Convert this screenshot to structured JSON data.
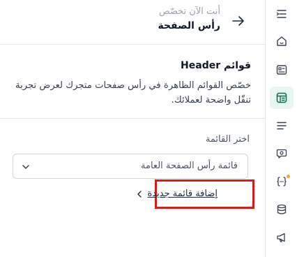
{
  "header": {
    "subtitle": "أنت الآن تخصّص",
    "title": "رأس الصفحة",
    "back_icon": "arrow-right-icon"
  },
  "menus_section": {
    "title": "قوائم Header",
    "description": "خصّص القوائم الظاهرة في رأس صفحات متجرك لعرض تجربة تنقّل واضحة لعملائك."
  },
  "menu_select": {
    "label": "اختر القائمة",
    "value": "قائمة رأس الصفحة العامة",
    "icon": "chevron-down-icon"
  },
  "add_menu": {
    "label": "إضافة قائمة جديدة",
    "icon": "chevron-left-icon",
    "highlight_color": "#d41c1c"
  },
  "sidebar": {
    "active_index": 3,
    "active_bg": "#e7f6ef",
    "accent": "#0f6b4f",
    "badge_color": "#f5a623",
    "items": [
      {
        "icon": "collapse-menu-icon"
      },
      {
        "icon": "home-icon"
      },
      {
        "icon": "id-card-icon"
      },
      {
        "icon": "layout-icon"
      },
      {
        "icon": "menu-lines-icon"
      },
      {
        "icon": "settings-chat-icon"
      },
      {
        "icon": "code-braces-icon",
        "badge": true
      },
      {
        "icon": "database-icon"
      },
      {
        "icon": "megaphone-icon"
      }
    ]
  }
}
